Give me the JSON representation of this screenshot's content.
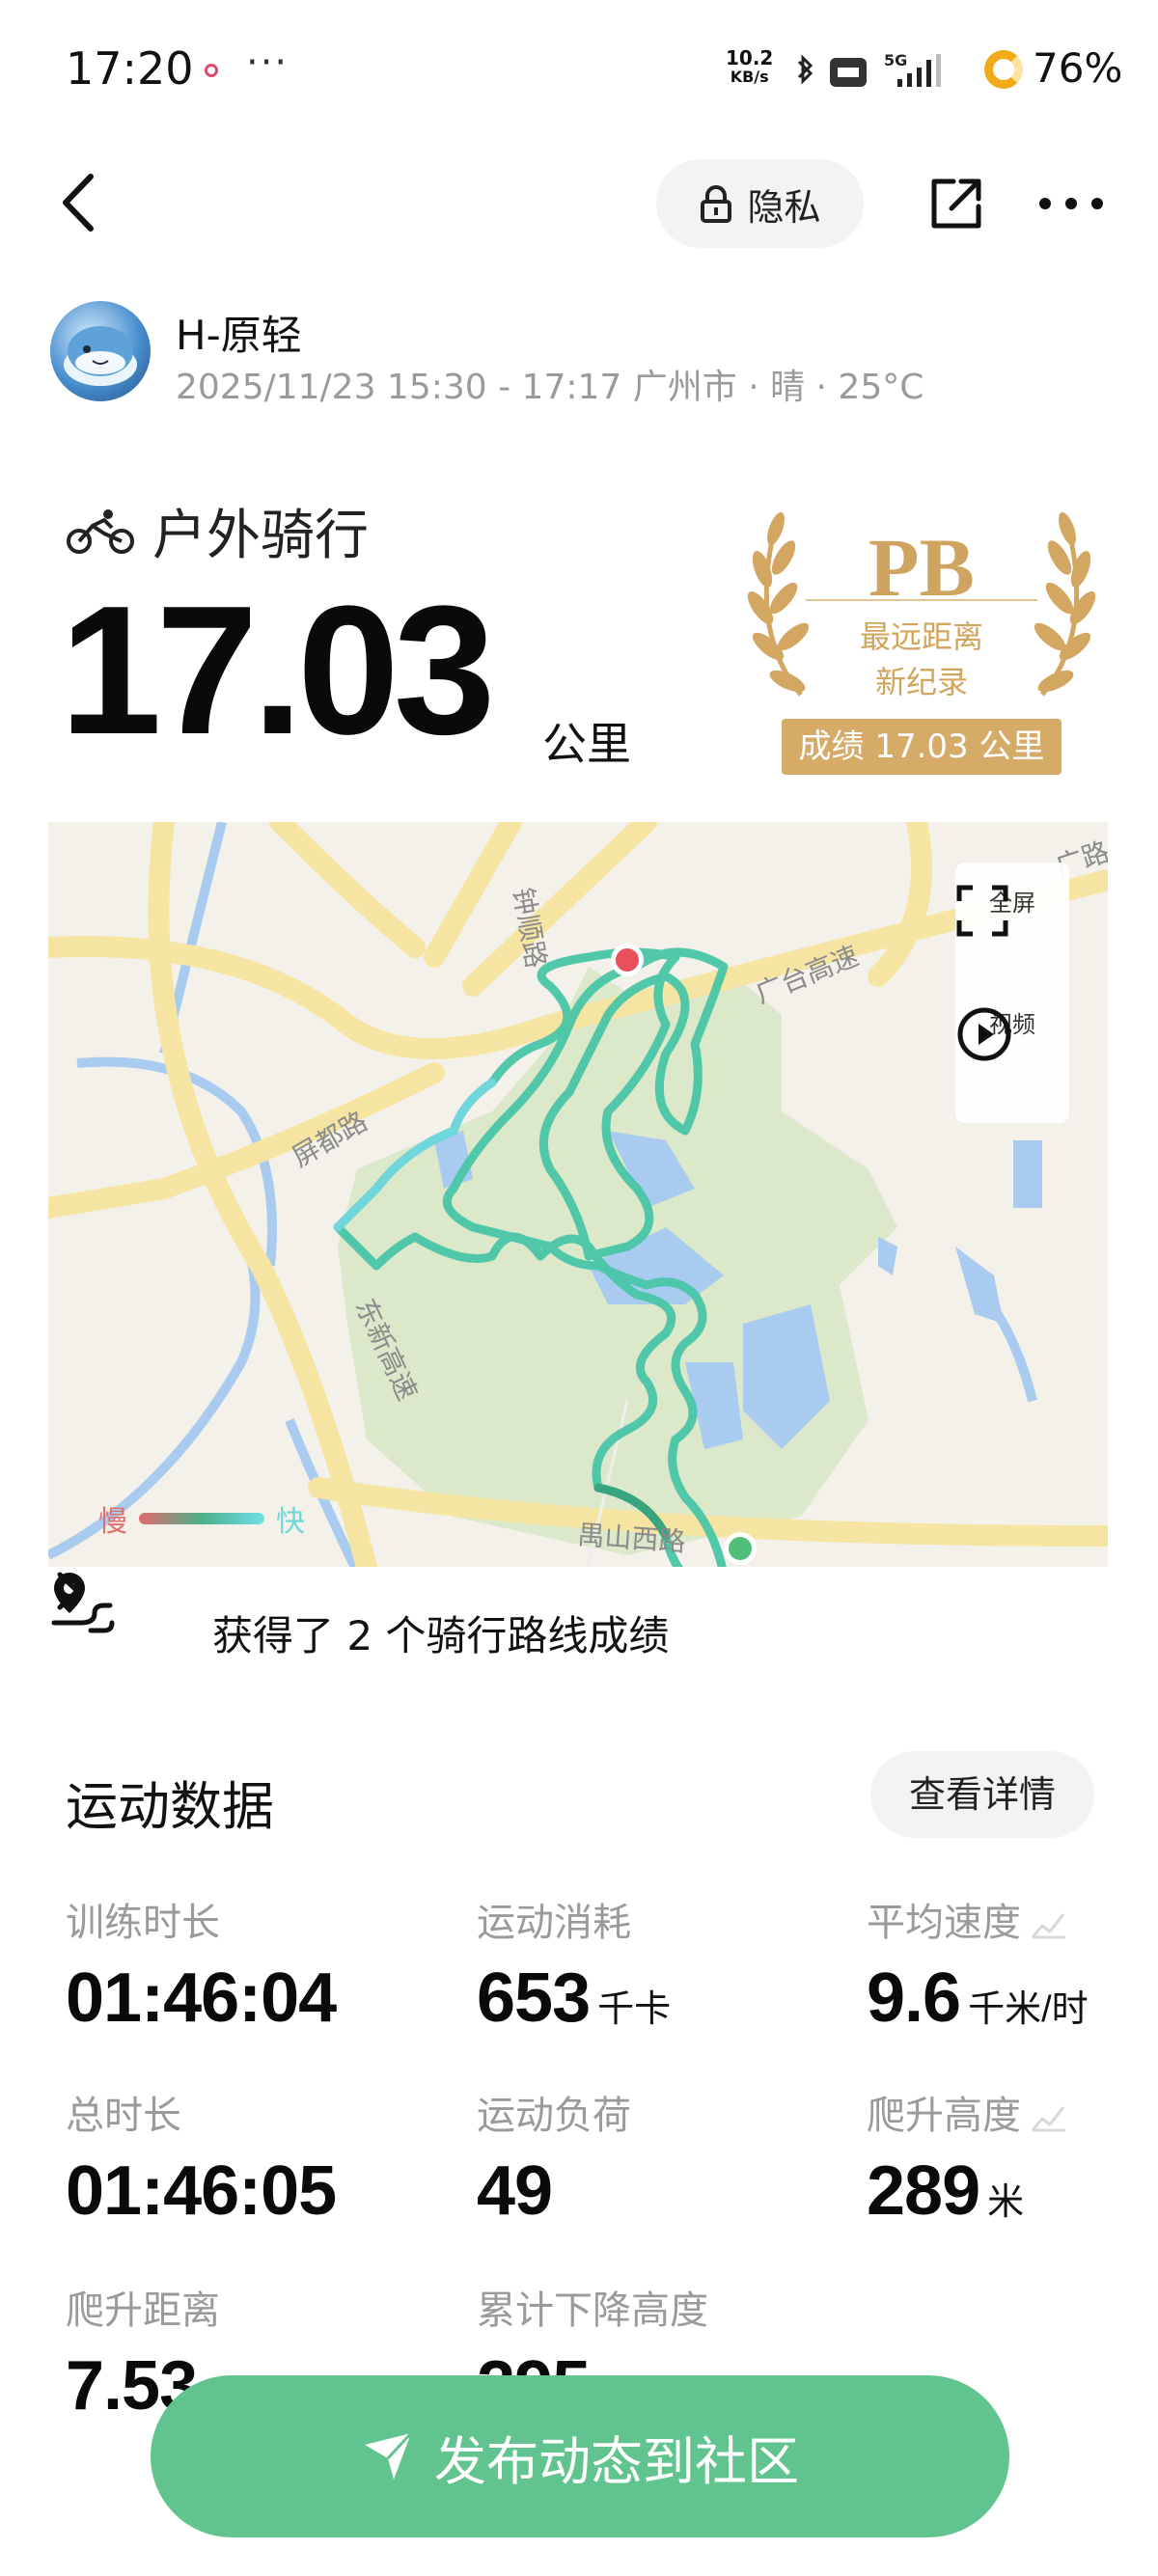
{
  "status_bar": {
    "time": "17:20",
    "more": "···",
    "net_speed_top": "10.2",
    "net_speed_bottom": "KB/s",
    "network": "5G",
    "battery": "76%"
  },
  "header": {
    "privacy_label": "隐私"
  },
  "user": {
    "name": "H-原轻",
    "meta": "2025/11/23 15:30 - 17:17 广州市 · 晴 · 25°C"
  },
  "activity": {
    "type": "户外骑行",
    "distance": "17.03",
    "distance_unit": "公里"
  },
  "pb_badge": {
    "title": "PB",
    "line1": "最远距离",
    "line2": "新纪录",
    "record": "成绩 17.03 公里"
  },
  "map": {
    "roads": {
      "zhongxun": "钟顺路",
      "guangtai": "广台高速",
      "pingdu": "屏都路",
      "dongxin": "东新高速",
      "yushan": "禺山西路",
      "guang_corner": "广路"
    },
    "controls": {
      "fullscreen": "全屏",
      "video": "视频"
    },
    "legend": {
      "slow": "慢",
      "fast": "快"
    },
    "route_achievement": "获得了 2 个骑行路线成绩"
  },
  "stats": {
    "title": "运动数据",
    "detail_button": "查看详情",
    "items": [
      {
        "label": "训练时长",
        "value": "01:46:04",
        "unit": ""
      },
      {
        "label": "运动消耗",
        "value": "653",
        "unit": "千卡"
      },
      {
        "label": "平均速度",
        "value": "9.6",
        "unit": "千米/时"
      },
      {
        "label": "总时长",
        "value": "01:46:05",
        "unit": ""
      },
      {
        "label": "运动负荷",
        "value": "49",
        "unit": ""
      },
      {
        "label": "爬升高度",
        "value": "289",
        "unit": "米"
      },
      {
        "label": "爬升距离",
        "value": "7.53",
        "unit": ""
      },
      {
        "label": "累计下降高度",
        "value": "295",
        "unit": ""
      }
    ]
  },
  "publish_button": "发布动态到社区",
  "colors": {
    "accent_green": "#61c48f",
    "pb_gold": "#d6aa67",
    "start_marker": "#e8505b",
    "end_marker": "#4fbf7a"
  }
}
